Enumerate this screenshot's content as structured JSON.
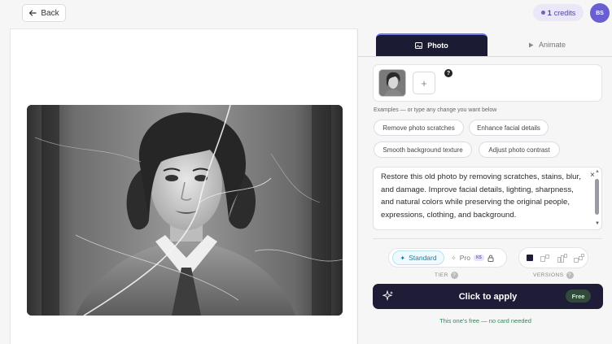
{
  "topbar": {
    "back_label": "Back",
    "credits_count": "1",
    "credits_label": "credits",
    "avatar_initials": "BS"
  },
  "tabs": [
    {
      "label": "Photo",
      "active": true
    },
    {
      "label": "Animate",
      "active": false
    }
  ],
  "upload": {
    "add_symbol": "+",
    "help_symbol": "?"
  },
  "examples": {
    "label": "Examples — or type any change you want below",
    "chips": [
      "Remove photo scratches",
      "Enhance facial details",
      "Smooth background texture",
      "Adjust photo contrast"
    ]
  },
  "prompt": {
    "text": "Restore this old photo by removing scratches, stains, blur, and damage. Improve facial details, lighting, sharpness, and natural colors while preserving the original people, expressions, clothing, and background.",
    "clear_symbol": "×"
  },
  "tier": {
    "label": "TIER",
    "standard_label": "Standard",
    "pro_label": "Pro",
    "pro_badge": "KS",
    "selected": "Standard",
    "help_symbol": "?"
  },
  "versions": {
    "label": "VERSIONS",
    "help_symbol": "?",
    "selected": 1,
    "count_options": 4
  },
  "apply": {
    "label": "Click to apply",
    "badge": "Free",
    "note": "This one's free — no card needed"
  },
  "colors": {
    "accent": "#6a5fd0",
    "dark": "#1e1c36",
    "free_green": "#2d8a56"
  }
}
